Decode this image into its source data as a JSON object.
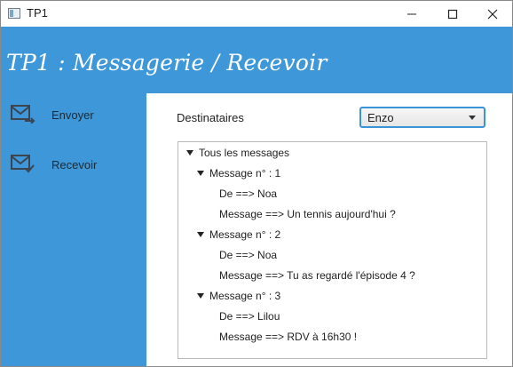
{
  "window": {
    "title": "TP1",
    "icon": "app-window-icon"
  },
  "header": {
    "title": "TP1 : Messagerie / Recevoir"
  },
  "sidebar": {
    "items": [
      {
        "label": "Envoyer",
        "icon": "mail-send-icon"
      },
      {
        "label": "Recevoir",
        "icon": "mail-check-icon"
      }
    ]
  },
  "main": {
    "recipients_label": "Destinataires",
    "recipients_selected": "Enzo",
    "tree": {
      "root": "Tous les messages",
      "messages": [
        {
          "label": "Message n° : 1",
          "from": "De ==> Noa",
          "body": "Message ==> Un tennis aujourd'hui ?"
        },
        {
          "label": "Message n° : 2",
          "from": "De ==> Noa",
          "body": "Message ==> Tu as regardé l'épisode 4 ?"
        },
        {
          "label": "Message n° : 3",
          "from": "De ==> Lilou",
          "body": "Message ==> RDV à 16h30 !"
        }
      ]
    }
  },
  "colors": {
    "accent": "#3d97d8",
    "panel": "#ffffff",
    "focus": "#3a94d8"
  }
}
